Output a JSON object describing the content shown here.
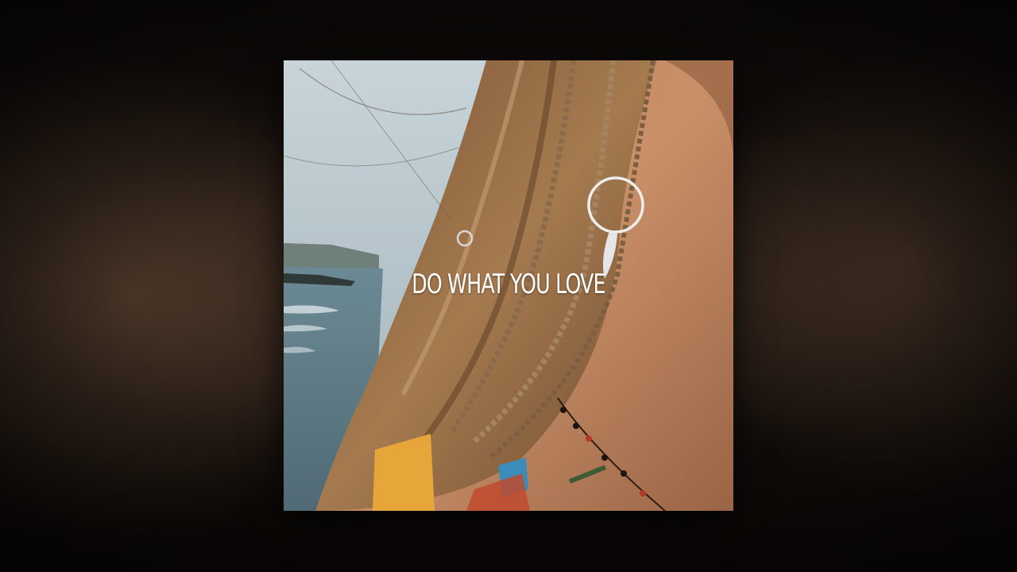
{
  "cover": {
    "title": "DO WHAT YOU LOVE"
  },
  "colors": {
    "background": "#0b0806",
    "sky": "#a9bcc4",
    "sea": "#5f7f8c",
    "hair": "#9a7047",
    "skin": "#c98d63",
    "text": "#ffffff"
  }
}
